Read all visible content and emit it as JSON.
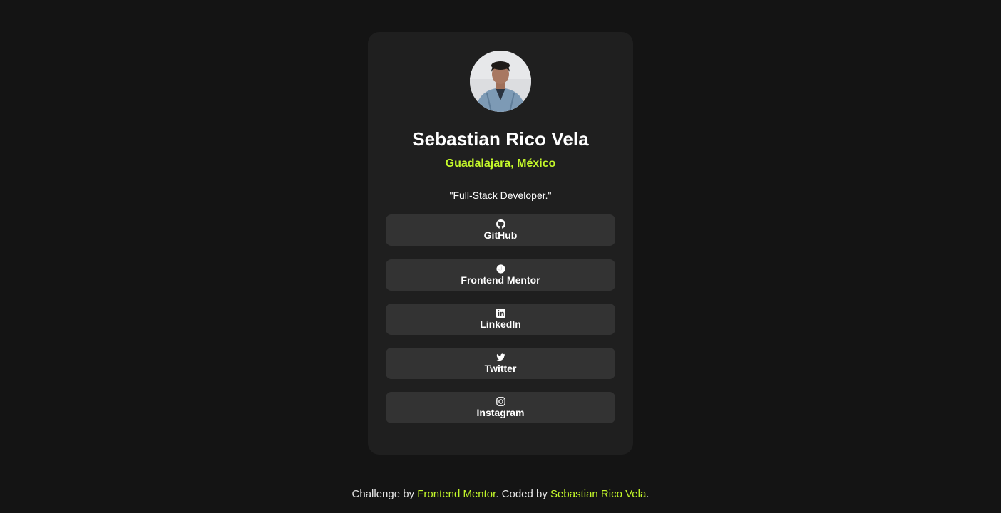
{
  "profile": {
    "name": "Sebastian Rico Vela",
    "location": "Guadalajara, México",
    "bio": "\"Full-Stack Developer.\""
  },
  "links": [
    {
      "label": "GitHub",
      "icon": "github-icon"
    },
    {
      "label": "Frontend Mentor",
      "icon": "frontend-mentor-icon"
    },
    {
      "label": "LinkedIn",
      "icon": "linkedin-icon"
    },
    {
      "label": "Twitter",
      "icon": "twitter-icon"
    },
    {
      "label": "Instagram",
      "icon": "instagram-icon"
    }
  ],
  "footer": {
    "prefix": "Challenge by ",
    "challenge_link": "Frontend Mentor",
    "middle": ". Coded by ",
    "author_link": "Sebastian Rico Vela",
    "suffix": "."
  },
  "colors": {
    "background": "#141414",
    "card": "#1f1f1f",
    "button": "#333333",
    "accent": "#c4f82a"
  }
}
